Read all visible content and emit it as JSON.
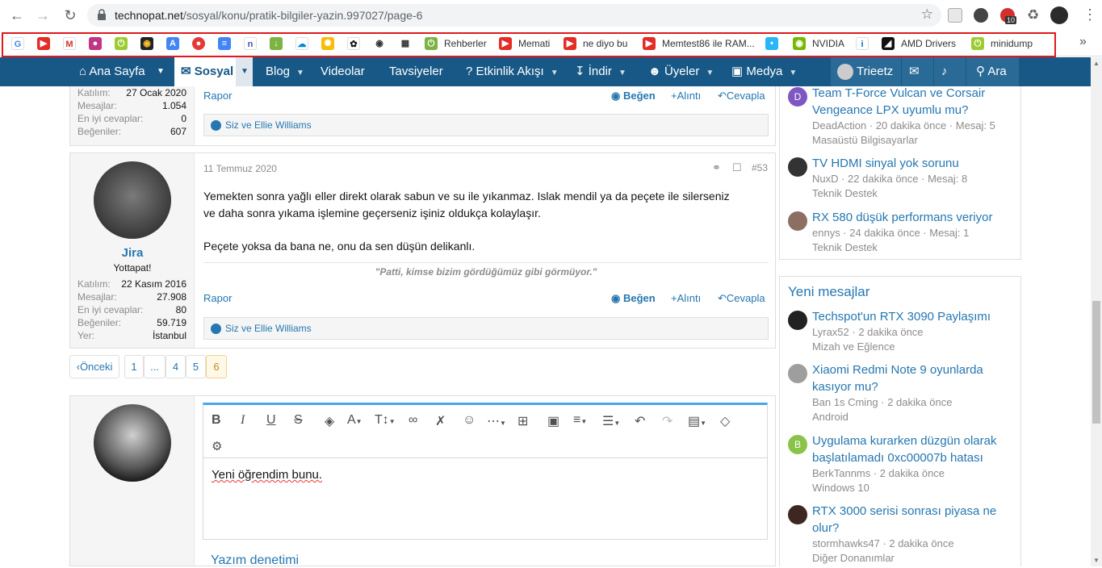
{
  "browser": {
    "url_host": "technopat.net",
    "url_path": "/sosyal/konu/pratik-bilgiler-yazin.997027/page-6",
    "ext_badge": "10"
  },
  "bookmarks": [
    {
      "label": "Rehberler",
      "color": "#7cb342"
    },
    {
      "label": "Memati",
      "color": "#e52d27"
    },
    {
      "label": "ne diyo bu",
      "color": "#e52d27"
    },
    {
      "label": "Memtest86 ile RAM...",
      "color": "#e52d27"
    },
    {
      "label": "NVIDIA",
      "color": "#76b900"
    },
    {
      "label": "AMD Drivers",
      "color": "#111111"
    },
    {
      "label": "minidump",
      "color": "#9ccc31"
    }
  ],
  "nav": {
    "home": "Ana Sayfa",
    "social": "Sosyal",
    "blog": "Blog",
    "videos": "Videolar",
    "recommendations": "Tavsiyeler",
    "activity": "Etkinlik Akışı",
    "download": "İndir",
    "members": "Üyeler",
    "media": "Medya",
    "user": "Trieetz",
    "search": "Ara"
  },
  "post1": {
    "stats": [
      {
        "k": "Katılım:",
        "v": "27 Ocak 2020"
      },
      {
        "k": "Mesajlar:",
        "v": "1.054"
      },
      {
        "k": "En iyi cevaplar:",
        "v": "0"
      },
      {
        "k": "Beğeniler:",
        "v": "607"
      }
    ],
    "report": "Rapor",
    "like": "Beğen",
    "quote": "Alıntı",
    "reply": "Cevapla",
    "likes": "Siz ve Ellie Williams"
  },
  "post2": {
    "date": "11 Temmuz 2020",
    "number": "#53",
    "username": "Jira",
    "title": "Yottapat!",
    "stats": [
      {
        "k": "Katılım:",
        "v": "22 Kasım 2016"
      },
      {
        "k": "Mesajlar:",
        "v": "27.908"
      },
      {
        "k": "En iyi cevaplar:",
        "v": "80"
      },
      {
        "k": "Beğeniler:",
        "v": "59.719"
      },
      {
        "k": "Yer:",
        "v": "İstanbul"
      }
    ],
    "body_line1": "Yemekten sonra yağlı eller direkt olarak sabun ve su ile yıkanmaz. Islak mendil ya da peçete ile silerseniz",
    "body_line2": "ve daha sonra yıkama işlemine geçerseniz işiniz oldukça kolaylaşır.",
    "body_line3": "Peçete yoksa da bana ne, onu da sen düşün delikanlı.",
    "signature": "\"Patti, kimse bizim gördüğümüz gibi görmüyor.\"",
    "report": "Rapor",
    "like": "Beğen",
    "quote": "Alıntı",
    "reply": "Cevapla",
    "likes": "Siz ve Ellie Williams"
  },
  "pagination": {
    "prev": "Önceki",
    "pages": [
      "1",
      "...",
      "4",
      "5",
      "6"
    ],
    "current": "6"
  },
  "editor": {
    "text": "Yeni öğrendim bunu.",
    "spellcheck": "Yazım denetimi"
  },
  "sidebar_top": [
    {
      "title1": "Team T-Force Vulcan ve Corsair",
      "title2": "Vengeance LPX uyumlu mu?",
      "meta": "DeadAction · 20 dakika önce · Mesaj: 5",
      "forum": "Masaüstü Bilgisayarlar",
      "avatar_letter": "D",
      "avatar_color": "#7e57c2"
    },
    {
      "title1": "TV HDMI sinyal yok sorunu",
      "title2": "",
      "meta": "NuxD · 22 dakika önce · Mesaj: 8",
      "forum": "Teknik Destek",
      "avatar_letter": "",
      "avatar_color": "#333333"
    },
    {
      "title1": "RX 580 düşük performans veriyor",
      "title2": "",
      "meta": "ennys · 24 dakika önce · Mesaj: 1",
      "forum": "Teknik Destek",
      "avatar_letter": "",
      "avatar_color": "#8d6e63"
    }
  ],
  "new_messages": {
    "heading": "Yeni mesajlar",
    "items": [
      {
        "title1": "Techspot'un RTX 3090 Paylaşımı",
        "title2": "",
        "meta": "Lyrax52 · 2 dakika önce",
        "forum": "Mizah ve Eğlence",
        "avatar_letter": "",
        "avatar_color": "#222222"
      },
      {
        "title1": "Xiaomi Redmi Note 9 oyunlarda",
        "title2": "kasıyor mu?",
        "meta": "Ban 1s Cming · 2 dakika önce",
        "forum": "Android",
        "avatar_letter": "",
        "avatar_color": "#9e9e9e"
      },
      {
        "title1": "Uygulama kurarken düzgün olarak",
        "title2": "başlatılamadı 0xc00007b hatası",
        "meta": "BerkTannms · 2 dakika önce",
        "forum": "Windows 10",
        "avatar_letter": "B",
        "avatar_color": "#8bc34a"
      },
      {
        "title1": "RTX 3000 serisi sonrası piyasa ne",
        "title2": "olur?",
        "meta": "stormhawks47 · 2 dakika önce",
        "forum": "Diğer Donanımlar",
        "avatar_letter": "",
        "avatar_color": "#3e2723"
      }
    ]
  }
}
